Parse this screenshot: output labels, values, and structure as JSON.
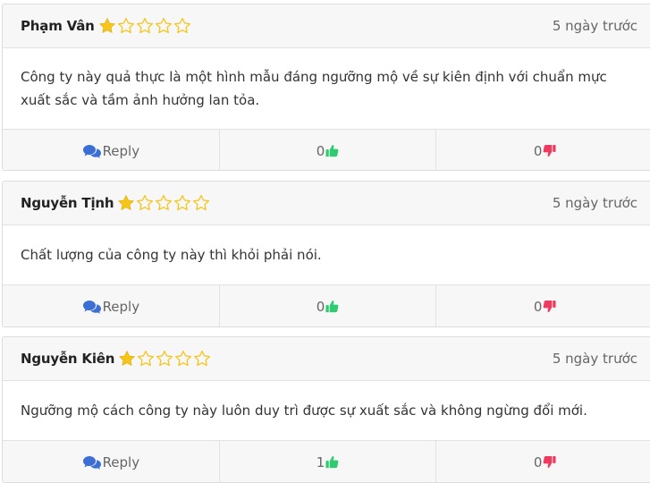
{
  "colors": {
    "star_filled": "#f5c518",
    "star_outline": "#f5c518",
    "reply_icon": "#3b6fd6",
    "like_icon": "#2ecc71",
    "dislike_icon": "#ee3a5e"
  },
  "icons": {
    "star": "star-icon",
    "reply": "comments-icon",
    "like": "thumbs-up-icon",
    "dislike": "thumbs-down-icon"
  },
  "reviews": [
    {
      "author": "Phạm Vân",
      "rating": 1,
      "max_rating": 5,
      "time": "5 ngày trước",
      "text": "Công ty này quả thực là một hình mẫu đáng ngưỡng mộ về sự kiên định với chuẩn mực xuất sắc và tầm ảnh hưởng lan tỏa.",
      "reply_label": "Reply",
      "likes": "0",
      "dislikes": "0"
    },
    {
      "author": "Nguyễn Tịnh",
      "rating": 1,
      "max_rating": 5,
      "time": "5 ngày trước",
      "text": "Chất lượng của công ty này thì khỏi phải nói.",
      "reply_label": "Reply",
      "likes": "0",
      "dislikes": "0"
    },
    {
      "author": "Nguyễn Kiên",
      "rating": 1,
      "max_rating": 5,
      "time": "5 ngày trước",
      "text": "Ngưỡng mộ cách công ty này luôn duy trì được sự xuất sắc và không ngừng đổi mới.",
      "reply_label": "Reply",
      "likes": "1",
      "dislikes": "0"
    }
  ]
}
